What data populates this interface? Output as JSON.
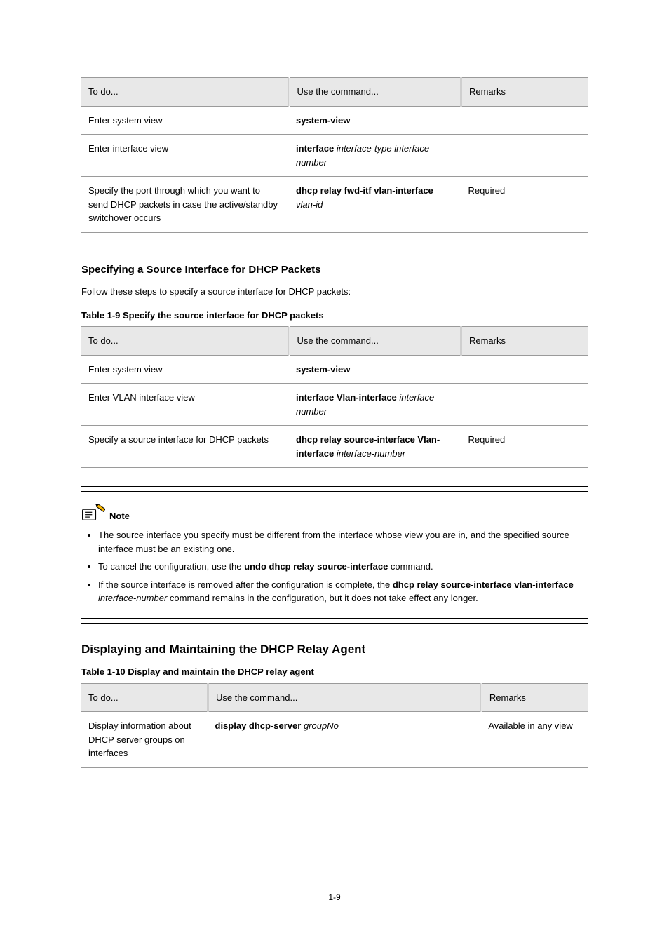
{
  "page_number": "1-9",
  "sections": {
    "spec_port": {
      "title": "Specifying a Source Interface for DHCP Packets",
      "intro": "Follow these steps to specify a source interface for DHCP packets:",
      "caption": "Table 1-9 Specify the source interface for DHCP packets"
    },
    "disp_maint": {
      "title": "Displaying and Maintaining the DHCP Relay Agent",
      "caption": "Table 1-10 Display and maintain the DHCP relay agent"
    }
  },
  "common_headers": [
    "To do...",
    "Use the command...",
    "Remarks"
  ],
  "table8": {
    "rows": [
      {
        "todo": "Enter system view",
        "cmd_b": "system-view",
        "cmd_i": "",
        "remarks": "—"
      },
      {
        "todo": "Enter interface view",
        "cmd_b": "interface",
        "cmd_i": " interface-type interface-number",
        "remarks": "—"
      },
      {
        "todo": "Specify the port through which you want to send DHCP packets in case the active/standby switchover occurs",
        "cmd_b": "dhcp relay fwd-itf vlan-interface",
        "cmd_i": " vlan-id",
        "remarks": "Required"
      }
    ]
  },
  "table9": {
    "rows": [
      {
        "todo": "Enter system view",
        "cmd_b": "system-view",
        "cmd_i": "",
        "remarks": "—"
      },
      {
        "todo": "Enter VLAN interface view",
        "cmd_b": "interface Vlan-interface",
        "cmd_i": " interface-number",
        "remarks": "—"
      },
      {
        "todo": "Specify a source interface for DHCP packets",
        "cmd_b": "dhcp relay source-interface Vlan-interface",
        "cmd_i": " interface-number",
        "remarks": "Required"
      }
    ]
  },
  "note": {
    "label": "Note",
    "bullets_html": [
      "The source interface you specify must be different from the interface whose view you are in, and the specified source interface must be an existing one.",
      "To cancel the configuration, use the <b>undo dhcp relay source-interface</b> command.",
      "If the source interface is removed after the configuration is complete, the <b>dhcp relay source-interface vlan-interface</b> <i>interface-number</i> command remains in the configuration, but it does not take effect any longer."
    ]
  },
  "table10": {
    "headers": [
      "To do...",
      "Use the command...",
      "Remarks"
    ],
    "rows": [
      {
        "todo": "Display information about DHCP server groups on interfaces",
        "cmd_html": "<b>display dhcp-server</b> <i>groupNo</i>",
        "remarks": "Available in any view"
      }
    ]
  }
}
